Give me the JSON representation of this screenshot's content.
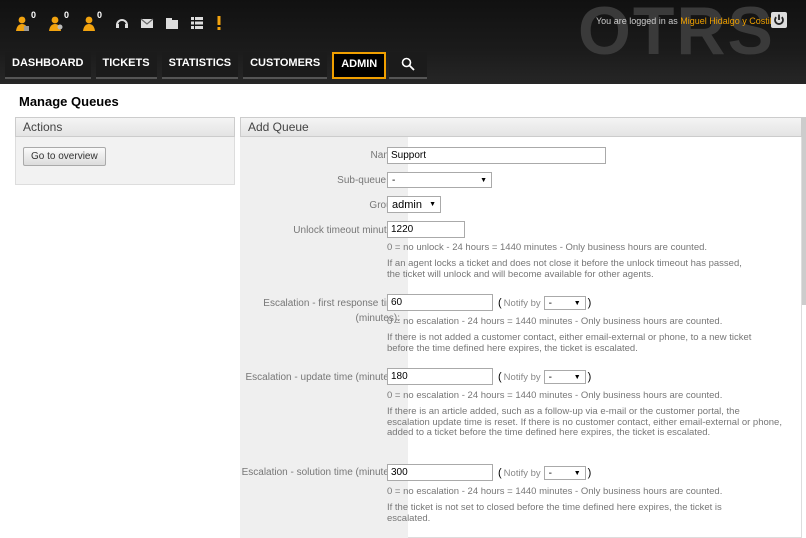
{
  "header": {
    "logo_text": "OTRS",
    "logged_in_prefix": "You are logged in as",
    "user_name": "Miguel Hidalgo y Costilla",
    "toolbar_counts": [
      "0",
      "0",
      "0"
    ],
    "nav": [
      {
        "label": "DASHBOARD"
      },
      {
        "label": "TICKETS"
      },
      {
        "label": "STATISTICS"
      },
      {
        "label": "CUSTOMERS"
      },
      {
        "label": "ADMIN",
        "selected": true
      }
    ],
    "accent_color": "#f09f00"
  },
  "page_title": "Manage Queues",
  "sidebar": {
    "title": "Actions",
    "button_label": "Go to overview"
  },
  "form": {
    "title": "Add Queue",
    "name_label": "Name:",
    "name_value": "Support",
    "subqueue_label": "Sub-queue of:",
    "subqueue_value": "-",
    "group_label": "Group:",
    "group_value": "admin",
    "unlock_label": "Unlock timeout minutes:",
    "unlock_value": "1220",
    "unlock_hint1": "0 = no unlock - 24 hours = 1440 minutes - Only business hours are counted.",
    "unlock_hint2": "If an agent locks a ticket and does not close it before the unlock timeout has passed, the ticket will unlock and will become available for other agents.",
    "esc_first_label_1": "Escalation - first response time",
    "esc_first_label_2": "(minutes):",
    "esc_first_value": "60",
    "notify_by": "Notify by",
    "notify_value": "-",
    "esc_hint": "0 = no escalation - 24 hours = 1440 minutes - Only business hours are counted.",
    "esc_first_hint2": "If there is not added a customer contact, either email-external or phone, to a new ticket before the time defined here expires, the ticket is escalated.",
    "esc_update_label": "Escalation - update time (minutes):",
    "esc_update_value": "180",
    "esc_update_hint2": "If there is an article added, such as a follow-up via e-mail or the customer portal, the escalation update time is reset. If there is no customer contact, either email-external or phone, added to a ticket before the time defined here expires, the ticket is escalated.",
    "esc_solution_label": "Escalation - solution time (minutes):",
    "esc_solution_value": "300",
    "esc_solution_hint2": "If the ticket is not set to closed before the time defined here expires, the ticket is escalated."
  }
}
